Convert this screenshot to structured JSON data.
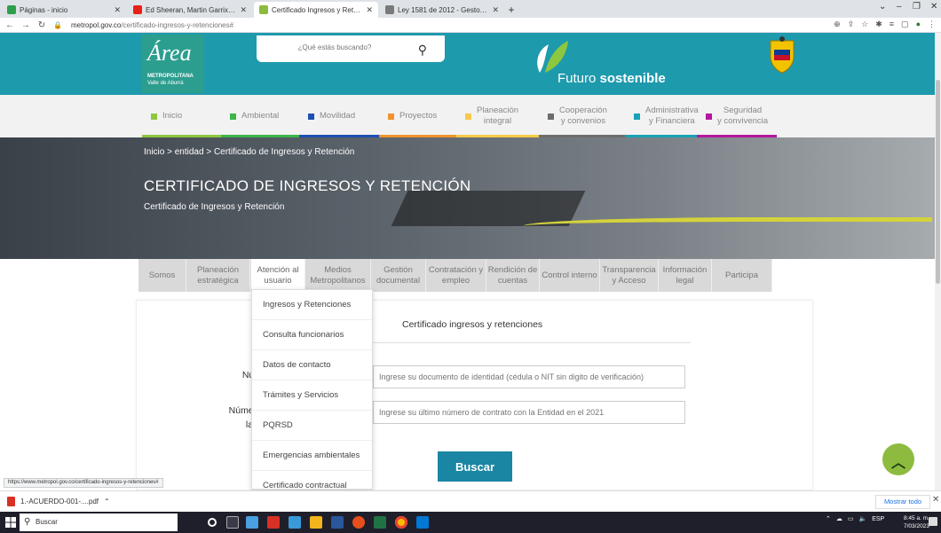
{
  "browser": {
    "tabs": [
      {
        "title": "Páginas - inicio",
        "fav": "#2e9f4a",
        "active": false
      },
      {
        "title": "Ed Sheeran, Martin Garrix, K...",
        "fav": "#e62117",
        "active": false
      },
      {
        "title": "Certificado Ingresos y Retencion...",
        "fav": "#8dbb3f",
        "active": true
      },
      {
        "title": "Ley 1581 de 2012 - Gestor Norm...",
        "fav": "#7a7a7a",
        "active": false
      }
    ],
    "url_host": "metropol.gov.co",
    "url_path": "/certificado-ingresos-y-retenciones#"
  },
  "header": {
    "logo_brand": "Área",
    "logo_line1": "METROPOLITANA",
    "logo_line2": "Valle de Aburrá",
    "search_placeholder": "¿Qué estás buscando?",
    "slogan_light": "Futuro ",
    "slogan_bold": "sostenible"
  },
  "main_nav": [
    {
      "label": "Inicio",
      "color": "#8dc63f"
    },
    {
      "label": "Ambiental",
      "color": "#3bb54a"
    },
    {
      "label": "Movilidad",
      "color": "#1f4fb3"
    },
    {
      "label": "Proyectos",
      "color": "#f0932b"
    },
    {
      "label": "Planeación\nintegral",
      "color": "#f7c948"
    },
    {
      "label": "Cooperación\ny convenios",
      "color": "#6d6d6d"
    },
    {
      "label": "Administrativa\ny Financiera",
      "color": "#18a3b5"
    },
    {
      "label": "Seguridad\ny convivencia",
      "color": "#b5179e"
    }
  ],
  "hero": {
    "breadcrumb": "Inicio > entidad > Certificado de Ingresos y Retención",
    "title": "CERTIFICADO DE INGRESOS Y RETENCIÓN",
    "subtitle": "Certificado de Ingresos y Retención"
  },
  "sub_nav": [
    {
      "label": "Somos",
      "active": false
    },
    {
      "label": "Planeación\nestratégica",
      "active": false
    },
    {
      "label": "Atención al\nusuario",
      "active": true
    },
    {
      "label": "Medios\nMetropolitanos",
      "active": false
    },
    {
      "label": "Gestión\ndocumental",
      "active": false
    },
    {
      "label": "Contratación y\nempleo",
      "active": false
    },
    {
      "label": "Rendición de\ncuentas",
      "active": false
    },
    {
      "label": "Control interno",
      "active": false
    },
    {
      "label": "Transparencia\ny Acceso",
      "active": false
    },
    {
      "label": "Información\nlegal",
      "active": false
    },
    {
      "label": "Participa",
      "active": false
    }
  ],
  "dropdown": [
    "Ingresos y Retenciones",
    "Consulta funcionarios",
    "Datos de contacto",
    "Trámites y Servicios",
    "PQRSD",
    "Emergencias ambientales",
    "Certificado contractual"
  ],
  "form": {
    "title": "Certificado ingresos y retenciones",
    "label_doc": "Núm",
    "label_contract_1": "Número",
    "label_contract_2": "la E",
    "doc_placeholder": "Ingrese su documento de identidad (cédula o NIT sin digito de verificación)",
    "contract_placeholder": "Ingrese su último número de contrato con la Entidad en el 2021",
    "submit": "Buscar"
  },
  "status_url": "https://www.metropol.gov.co/certificado-ingresos-y-retenciones#",
  "downloads": {
    "file": "1.-ACUERDO-001-....pdf",
    "show_all": "Mostrar todo"
  },
  "taskbar": {
    "search": "Buscar",
    "lang": "ESP",
    "time": "8:45 a. m.",
    "date": "7/03/2023"
  }
}
